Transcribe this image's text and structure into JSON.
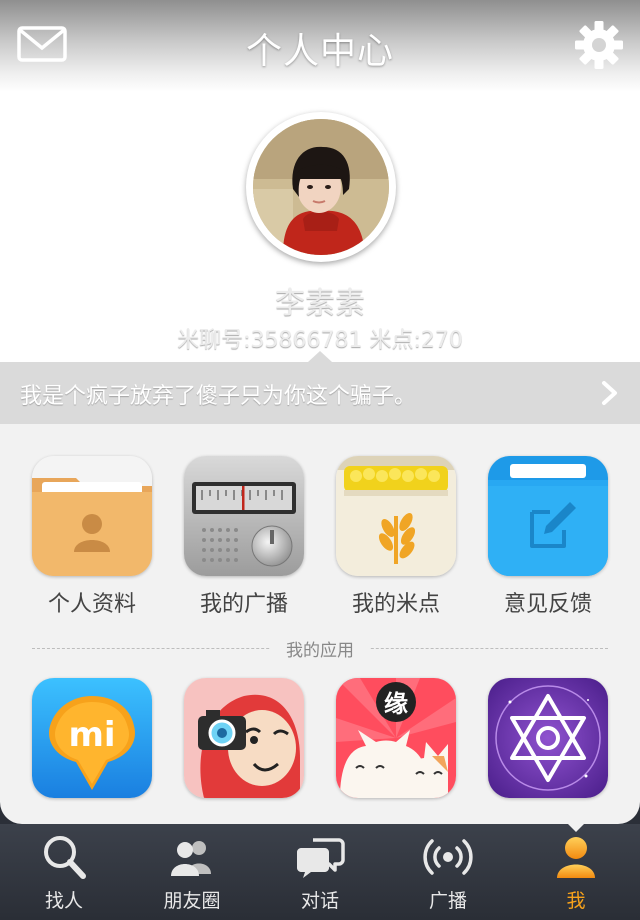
{
  "header": {
    "title": "个人中心",
    "left_icon": "mail-icon",
    "right_icon": "gear-icon"
  },
  "profile": {
    "name": "李素素",
    "info": "米聊号:35866781 米点:270"
  },
  "signature": {
    "text": "我是个疯子放弃了傻子只为你这个骗子。",
    "icon": "chevron-right-icon"
  },
  "features": [
    {
      "label": "个人资料",
      "icon": "profile-folder-icon"
    },
    {
      "label": "我的广播",
      "icon": "radio-icon"
    },
    {
      "label": "我的米点",
      "icon": "rice-points-icon"
    },
    {
      "label": "意见反馈",
      "icon": "feedback-folder-icon"
    }
  ],
  "apps_section": {
    "title": "我的应用",
    "apps": [
      {
        "icon": "mi-location-app-icon"
      },
      {
        "icon": "camera-doll-app-icon"
      },
      {
        "icon": "cat-match-app-icon",
        "badge": "缘"
      },
      {
        "icon": "star-of-david-app-icon"
      }
    ]
  },
  "tabbar": {
    "active_color": "#f7a21b",
    "items": [
      {
        "label": "找人",
        "icon": "search-icon",
        "active": false
      },
      {
        "label": "朋友圈",
        "icon": "friends-icon",
        "active": false
      },
      {
        "label": "对话",
        "icon": "chat-icon",
        "active": false
      },
      {
        "label": "广播",
        "icon": "broadcast-icon",
        "active": false
      },
      {
        "label": "我",
        "icon": "me-icon",
        "active": true
      }
    ]
  }
}
